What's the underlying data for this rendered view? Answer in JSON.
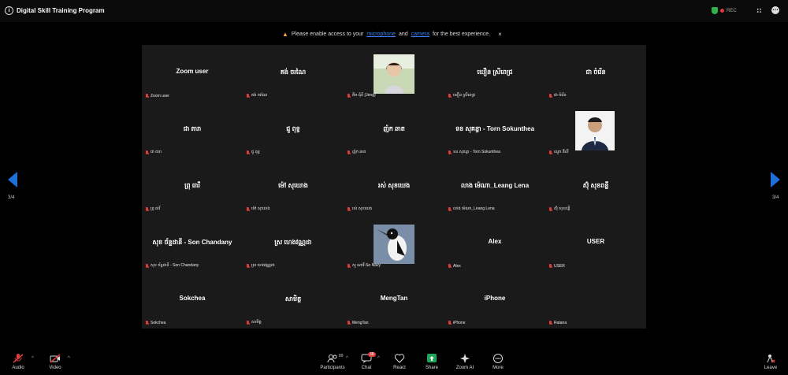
{
  "app": {
    "title": "Digital Skill Training Program"
  },
  "recording": {
    "label": "REC"
  },
  "notice": {
    "text_before": "Please enable access to your",
    "link1": "microphone",
    "and": "and",
    "link2": "camera",
    "text_after": "for the best experience.",
    "close": "×"
  },
  "page": {
    "left": "3/4",
    "right": "3/4"
  },
  "tiles": [
    {
      "name": "Zoom user",
      "label": "Zoom user"
    },
    {
      "name": "គង់ ចរណៃ",
      "label": "គង់ ចរណៃ"
    },
    {
      "name": "",
      "label": "គីម ជុំនី (Jeng)",
      "photo": "woman-portrait"
    },
    {
      "name": "ឃឿន ស្រីពេជ្រ",
      "label": "ឃឿន ស្រីពេជ្រ"
    },
    {
      "name": "ជា ចំរើន",
      "label": "ជា ចំរើន"
    },
    {
      "name": "ជា តារា",
      "label": "ជា តារា"
    },
    {
      "name": "ជួ ពុទ្ធ",
      "label": "ជួ ពុទ្ធ"
    },
    {
      "name": "ញ៉ក ឆាត",
      "label": "ញ៉ក ឆាត"
    },
    {
      "name": "ទន សុគន្ធា - Torn Sokunthea",
      "label": "ទន សុគន្ធា - Torn Sokunthea"
    },
    {
      "name": "",
      "label": "ឈួក គីលី",
      "photo": "man-portrait"
    },
    {
      "name": "ព្រុ ធារី",
      "label": "ព្រុ ធារី"
    },
    {
      "name": "ម៉ៅ សុឃោង",
      "label": "ម៉ៅ សុឃោង"
    },
    {
      "name": "រស់ សុខឃេង",
      "label": "រស់ សុខឃេង"
    },
    {
      "name": "លាង ម៉េណា_Leang Lena",
      "label": "លាង ម៉េណា_Leang Lena"
    },
    {
      "name": "ស៊ុំ សុខពន្លឺ",
      "label": "ស៊ុំ សុខពន្លឺ"
    },
    {
      "name": "សុខ ច័ន្ទដានី - Son Chandany",
      "label": "សុខ ច័ន្ទដានី - Son Chandany"
    },
    {
      "name": "ស្រ ហេងវណ្ណដា",
      "label": "ស្រ ហេងវណ្ណដា"
    },
    {
      "name": "",
      "label": "សួ ណាវី-So Navy",
      "photo": "bird-photo"
    },
    {
      "name": "Alex",
      "label": "Alex"
    },
    {
      "name": "USER",
      "label": "USER"
    },
    {
      "name": "Sokchea",
      "label": "Sokchea"
    },
    {
      "name": "សាមិត្ត",
      "label": "សាមិត្ត"
    },
    {
      "name": "MengTan",
      "label": "MengTan"
    },
    {
      "name": "iPhone",
      "label": "iPhone"
    },
    {
      "name": "",
      "label": "Ratana"
    }
  ],
  "toolbar": {
    "audio": "Audio",
    "video": "Video",
    "participants": "Participants",
    "participants_count": "89",
    "chat": "Chat",
    "chat_badge": "38",
    "react": "React",
    "share": "Share",
    "zoom_ai": "Zoom AI",
    "more": "More",
    "leave": "Leave"
  },
  "colors": {
    "accent": "#1e6fd9",
    "share": "#22a35a",
    "leave": "#e03b3b",
    "mute": "#e03b3b",
    "shield": "#2fb24c"
  }
}
